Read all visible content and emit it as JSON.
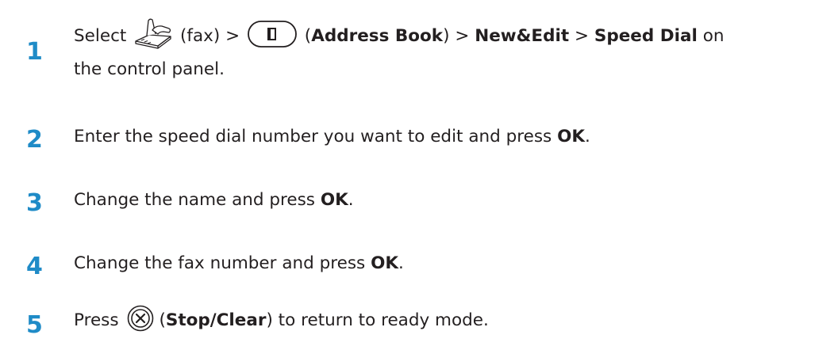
{
  "colors": {
    "step_number": "#1f8bc7",
    "text": "#231f20"
  },
  "steps": [
    {
      "number": "1",
      "parts": {
        "select": "Select",
        "fax_paren": "(fax) >",
        "open_paren": "(",
        "address_book": "Address Book",
        "close_gt": ") >",
        "new_edit": "New&Edit",
        "gt": ">",
        "speed_dial": "Speed Dial",
        "on": "on",
        "line2": "the control panel."
      },
      "icons": [
        "fax-icon",
        "address-book-icon"
      ]
    },
    {
      "number": "2",
      "parts": {
        "text": "Enter the speed dial number you want to edit and press",
        "ok": "OK",
        "end": "."
      }
    },
    {
      "number": "3",
      "parts": {
        "text": "Change the name and press",
        "ok": "OK",
        "end": "."
      }
    },
    {
      "number": "4",
      "parts": {
        "text": "Change the fax number and press",
        "ok": "OK",
        "end": "."
      }
    },
    {
      "number": "5",
      "parts": {
        "press": "Press",
        "open_paren": "(",
        "stop_clear": "Stop/Clear",
        "end": ") to return to ready mode."
      },
      "icons": [
        "stop-clear-icon"
      ]
    }
  ]
}
